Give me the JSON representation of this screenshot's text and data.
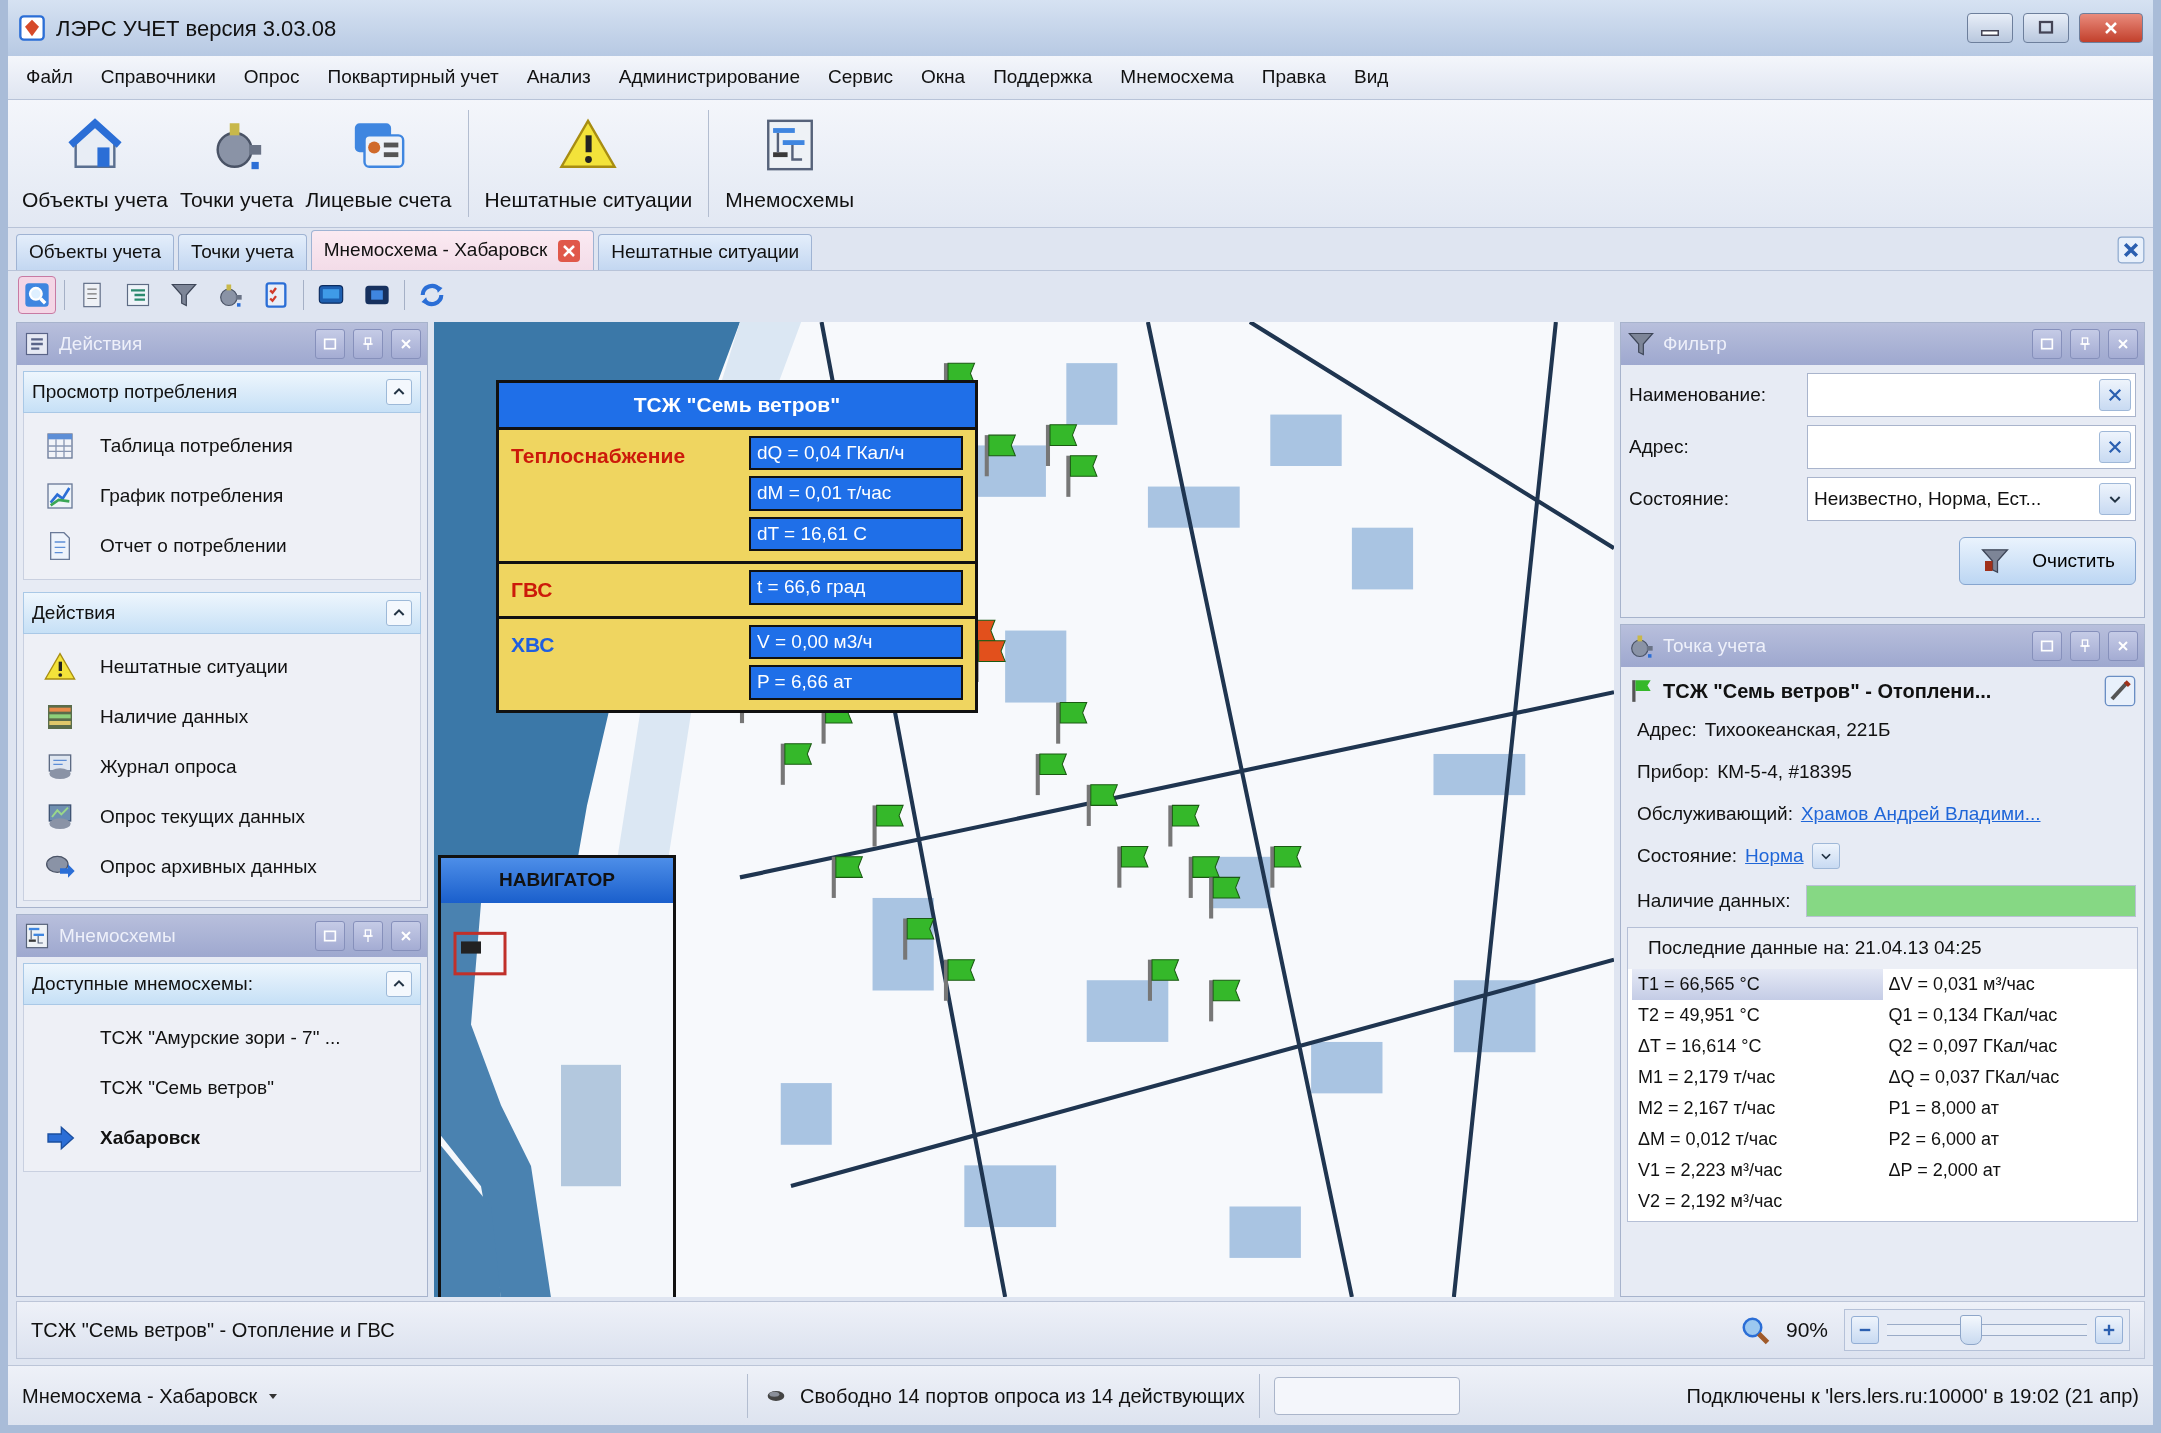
{
  "window": {
    "title": "ЛЭРС УЧЕТ версия 3.03.08"
  },
  "menu": [
    {
      "label": "Файл"
    },
    {
      "label": "Справочники"
    },
    {
      "label": "Опрос"
    },
    {
      "label": "Поквартирный учет"
    },
    {
      "label": "Анализ"
    },
    {
      "label": "Администрирование"
    },
    {
      "label": "Сервис"
    },
    {
      "label": "Окна"
    },
    {
      "label": "Поддержка"
    },
    {
      "label": "Мнемосхема"
    },
    {
      "label": "Правка"
    },
    {
      "label": "Вид"
    }
  ],
  "toolbar": [
    {
      "label": "Объекты учета",
      "kind": "house"
    },
    {
      "label": "Точки учета",
      "kind": "valve"
    },
    {
      "label": "Лицевые счета",
      "kind": "cards"
    },
    {
      "kind": "separator"
    },
    {
      "label": "Нештатные ситуации",
      "kind": "warning"
    },
    {
      "kind": "separator"
    },
    {
      "label": "Мнемосхемы",
      "kind": "diagram"
    }
  ],
  "tabs": [
    {
      "label": "Объекты учета",
      "selected": false,
      "closable": false
    },
    {
      "label": "Точки учета",
      "selected": false,
      "closable": false
    },
    {
      "label": "Мнемосхема - Хабаровск",
      "selected": true,
      "closable": true
    },
    {
      "label": "Нештатные ситуации",
      "selected": false,
      "closable": false
    }
  ],
  "tools": [
    {
      "kind": "magnifier",
      "selected": true
    },
    {
      "kind": "separator"
    },
    {
      "kind": "page",
      "selected": false
    },
    {
      "kind": "list",
      "selected": false
    },
    {
      "kind": "filter",
      "selected": false
    },
    {
      "kind": "valve",
      "selected": false
    },
    {
      "kind": "checklist",
      "selected": false
    },
    {
      "kind": "separator"
    },
    {
      "kind": "monitor",
      "selected": false
    },
    {
      "kind": "screen",
      "selected": false
    },
    {
      "kind": "separator"
    },
    {
      "kind": "refresh",
      "selected": false
    }
  ],
  "actions_panel": {
    "title": "Действия",
    "groups": [
      {
        "title": "Просмотр потребления",
        "expanded": true,
        "items": [
          {
            "label": "Таблица потребления",
            "kind": "table"
          },
          {
            "label": "График потребления",
            "kind": "chart"
          },
          {
            "label": "Отчет о потреблении",
            "kind": "document"
          }
        ]
      },
      {
        "title": "Действия",
        "expanded": true,
        "items": [
          {
            "label": "Нештатные ситуации",
            "kind": "warning"
          },
          {
            "label": "Наличие данных",
            "kind": "grid"
          },
          {
            "label": "Журнал опроса",
            "kind": "journal"
          },
          {
            "label": "Опрос текущих данных",
            "kind": "poll"
          },
          {
            "label": "Опрос архивных данных",
            "kind": "archive"
          }
        ]
      }
    ]
  },
  "mnemo_panel": {
    "title": "Мнемосхемы",
    "groups": [
      {
        "title": "Доступные мнемосхемы:",
        "expanded": true,
        "items": [
          {
            "label": "ТСЖ \"Амурские зори - 7\" ...",
            "selected": false
          },
          {
            "label": "ТСЖ \"Семь ветров\"",
            "selected": false
          },
          {
            "label": "Хабаровск",
            "selected": true
          }
        ]
      }
    ]
  },
  "map": {
    "popup": {
      "title": "ТСЖ \"Семь ветров\"",
      "sections": [
        {
          "label": "Теплоснабжение",
          "color": "#cc1a0a",
          "values": [
            "dQ = 0,04 ГКал/ч",
            "dM = 0,01 т/час",
            "dT = 16,61 С"
          ]
        },
        {
          "label": "ГВС",
          "color": "#cc1a0a",
          "values": [
            "t = 66,6 град"
          ]
        },
        {
          "label": "ХВС",
          "color": "#1f5fe0",
          "values": [
            "V = 0,00 м3/ч",
            "P = 6,66 ат"
          ]
        }
      ]
    },
    "navigator": {
      "title": "НАВИГАТОР"
    }
  },
  "filter_panel": {
    "title": "Фильтр",
    "fields": [
      {
        "label": "Наименование:",
        "kind": "clearable"
      },
      {
        "label": "Адрес:",
        "kind": "clearable"
      },
      {
        "label": "Состояние:",
        "kind": "dropdown",
        "value": "Неизвестно, Норма, Ест..."
      }
    ],
    "clear_button": "Очистить"
  },
  "point_panel": {
    "title": "Точка учета",
    "name": "ТСЖ \"Семь ветров\" - Отоплени...",
    "details": [
      {
        "label": "Адрес:",
        "value": "Тихоокеанская, 221Б",
        "kind": "text"
      },
      {
        "label": "Прибор:",
        "value": "КМ-5-4, #18395",
        "kind": "text"
      },
      {
        "label": "Обслуживающий:",
        "value": "Храмов Андрей Владими...",
        "kind": "link"
      },
      {
        "label": "Состояние:",
        "value": "Норма",
        "kind": "dropdown-link"
      }
    ],
    "data_presence": {
      "label": "Наличие данных:",
      "level": 1
    },
    "last_data": "Последние данные на: 21.04.13 04:25",
    "readings_column_1": [
      {
        "text": "T1 = 66,565 °C",
        "selected": true
      },
      {
        "text": "T2 = 49,951 °C",
        "selected": false
      },
      {
        "text": "ΔT = 16,614 °C",
        "selected": false
      },
      {
        "text": "M1 = 2,179 т/час",
        "selected": false
      },
      {
        "text": "M2 = 2,167 т/час",
        "selected": false
      },
      {
        "text": "ΔM = 0,012 т/час",
        "selected": false
      },
      {
        "text": "V1 = 2,223 м³/час",
        "selected": false
      },
      {
        "text": "V2 = 2,192 м³/час",
        "selected": false
      }
    ],
    "readings_column_2": [
      {
        "text": "ΔV = 0,031 м³/час",
        "selected": false
      },
      {
        "text": "Q1 = 0,134 ГКал/час",
        "selected": false
      },
      {
        "text": "Q2 = 0,097 ГКал/час",
        "selected": false
      },
      {
        "text": "ΔQ = 0,037 ГКал/час",
        "selected": false
      },
      {
        "text": "P1 = 8,000 ат",
        "selected": false
      },
      {
        "text": "P2 = 6,000 ат",
        "selected": false
      },
      {
        "text": "ΔP = 2,000 ат",
        "selected": false
      }
    ]
  },
  "footer": {
    "caption": "ТСЖ \"Семь ветров\" - Отопление и ГВС",
    "zoom": {
      "reading": "90%",
      "level": 0.42
    }
  },
  "status_bar": {
    "window_menu": "Мнемосхема - Хабаровск",
    "ports": "Свободно 14 портов опроса из 14 действующих",
    "connection": "Подключены к 'lers.lers.ru:10000' в 19:02 (21 апр)"
  }
}
